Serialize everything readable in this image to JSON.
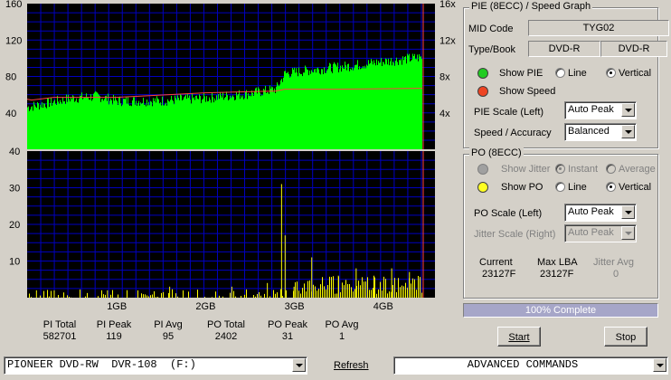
{
  "pie_chart": {
    "left_ticks": [
      "160",
      "120",
      "80",
      "40"
    ],
    "right_ticks": [
      "16x",
      "12x",
      "8x",
      "4x"
    ]
  },
  "po_chart": {
    "left_ticks": [
      "40",
      "30",
      "20",
      "10"
    ],
    "x_ticks": [
      "1GB",
      "2GB",
      "3GB",
      "4GB"
    ]
  },
  "chart_data": [
    {
      "type": "area",
      "title": "",
      "xlabel": "",
      "ylabel": "",
      "x_unit": "GB",
      "xlim": [
        0,
        4.45
      ],
      "ylim": [
        0,
        160
      ],
      "y2lim": [
        0,
        16
      ],
      "series": [
        {
          "x": [
            0,
            0.5,
            0.8,
            1.0,
            1.5,
            2.0,
            2.5,
            2.8,
            2.9,
            3.2,
            3.6,
            4.0,
            4.45
          ],
          "values": [
            45,
            55,
            57,
            52,
            52,
            55,
            60,
            65,
            82,
            86,
            90,
            95,
            100
          ],
          "color": "#00ff00"
        },
        {
          "x": [
            0,
            0.05,
            0.3,
            1.0,
            2.0,
            2.8,
            2.9,
            3.5,
            4.45
          ],
          "values": [
            55,
            54,
            57,
            57,
            62,
            64,
            66,
            66,
            67
          ],
          "color": "#ff4040"
        }
      ]
    },
    {
      "type": "bar",
      "title": "",
      "xlabel": "",
      "ylabel": "",
      "x_unit": "GB",
      "xlim": [
        0,
        4.45
      ],
      "ylim": [
        0,
        40
      ],
      "series": [
        {
          "x": [
            0.1,
            0.3,
            0.9,
            1.6,
            2.3,
            2.7,
            2.86,
            2.9,
            3.0,
            3.2,
            3.5,
            3.7,
            3.9,
            4.1,
            4.3,
            4.4
          ],
          "values": [
            2,
            2,
            2,
            3,
            3,
            4,
            31,
            17,
            3,
            11,
            6,
            8,
            6,
            8,
            7,
            5
          ],
          "color": "#ffff00"
        }
      ]
    }
  ],
  "stats": [
    {
      "label": "PI Total",
      "value": "582701"
    },
    {
      "label": "PI Peak",
      "value": "119"
    },
    {
      "label": "PI Avg",
      "value": "95"
    },
    {
      "label": "PO Total",
      "value": "2402"
    },
    {
      "label": "PO Peak",
      "value": "31"
    },
    {
      "label": "PO Avg",
      "value": "1"
    }
  ],
  "pie_group": {
    "title": "PIE (8ECC) / Speed Graph",
    "mid_code_label": "MID Code",
    "mid_code_value": "TYG02",
    "type_book_label": "Type/Book",
    "type_value": "DVD-R",
    "book_value": "DVD-R",
    "show_pie_label": "Show PIE",
    "show_speed_label": "Show Speed",
    "line_label": "Line",
    "vertical_label": "Vertical",
    "pie_scale_label": "PIE Scale (Left)",
    "pie_scale_value": "Auto Peak",
    "speed_accuracy_label": "Speed / Accuracy",
    "speed_accuracy_value": "Balanced"
  },
  "po_group": {
    "title": "PO (8ECC)",
    "show_jitter_label": "Show Jitter",
    "instant_label": "Instant",
    "average_label": "Average",
    "show_po_label": "Show PO",
    "line_label": "Line",
    "vertical_label": "Vertical",
    "po_scale_label": "PO Scale (Left)",
    "po_scale_value": "Auto Peak",
    "jitter_scale_label": "Jitter Scale (Right)",
    "jitter_scale_value": "Auto Peak",
    "current_label": "Current",
    "current_value": "23127F",
    "max_lba_label": "Max LBA",
    "max_lba_value": "23127F",
    "jitter_avg_label": "Jitter Avg",
    "jitter_avg_value": "0"
  },
  "progress": {
    "text": "100% Complete",
    "percent": 100
  },
  "buttons": {
    "start": "Start",
    "stop": "Stop",
    "refresh": "Refresh"
  },
  "drive": {
    "selected": "PIONEER DVD-RW  DVR-108  (F:)"
  },
  "commands": {
    "selected": "ADVANCED COMMANDS"
  },
  "colors": {
    "pie": "#00ff00",
    "speed": "#ff4040",
    "po": "#ffff00",
    "grid": "#0000c0"
  }
}
